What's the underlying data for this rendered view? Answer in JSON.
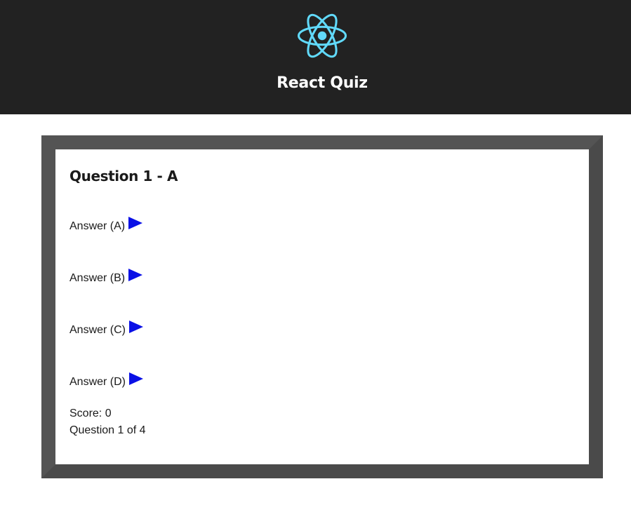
{
  "header": {
    "logo_icon": "react-atom-icon",
    "logo_color": "#61dafb",
    "title": "React Quiz",
    "background": "#222222"
  },
  "quiz": {
    "question_title": "Question 1 - A",
    "answers": [
      {
        "label": "Answer (A)",
        "icon": "play-arrow-icon"
      },
      {
        "label": "Answer (B)",
        "icon": "play-arrow-icon"
      },
      {
        "label": "Answer (C)",
        "icon": "play-arrow-icon"
      },
      {
        "label": "Answer (D)",
        "icon": "play-arrow-icon"
      }
    ],
    "arrow_color": "#0a10e6",
    "score_text": "Score: 0",
    "progress_text": "Question 1 of 4"
  }
}
